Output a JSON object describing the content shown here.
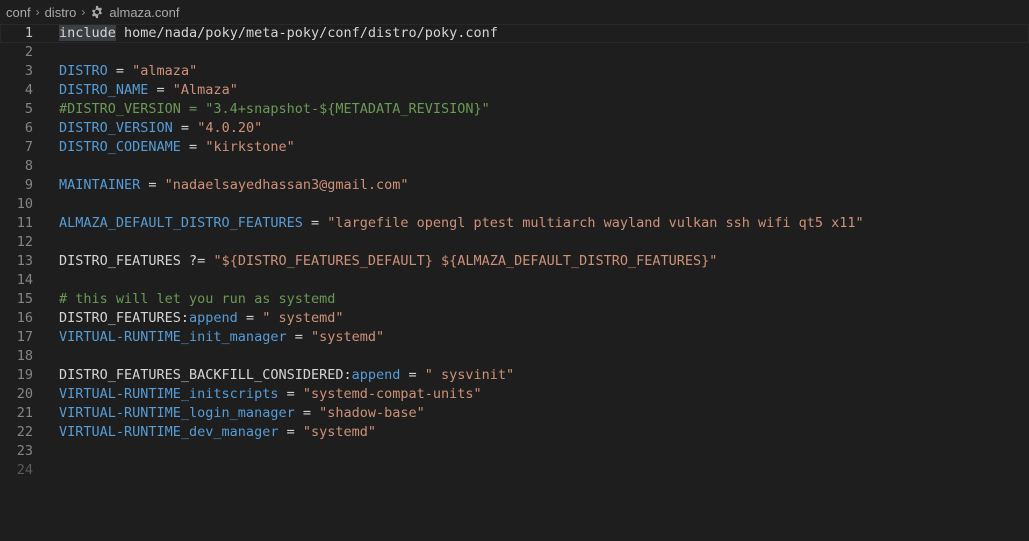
{
  "breadcrumb": {
    "items": [
      "conf",
      "distro",
      "almaza.conf"
    ],
    "file_icon": "gear-icon"
  },
  "colors": {
    "background": "#1e1e1e",
    "variable": "#569cd6",
    "string": "#ce9178",
    "comment": "#6a9955",
    "plain": "#d4d4d4",
    "line_number": "#858585"
  },
  "editor": {
    "current_line": 1,
    "lines": [
      {
        "n": "1",
        "tokens": [
          {
            "t": "include",
            "c": "t-plain kw-hl"
          },
          {
            "t": " home/nada/poky/meta-poky/conf/distro/poky.conf",
            "c": "t-path"
          }
        ]
      },
      {
        "n": "2",
        "tokens": []
      },
      {
        "n": "3",
        "tokens": [
          {
            "t": "DISTRO",
            "c": "t-var"
          },
          {
            "t": " = ",
            "c": "t-plain"
          },
          {
            "t": "\"almaza\"",
            "c": "t-str"
          }
        ]
      },
      {
        "n": "4",
        "tokens": [
          {
            "t": "DISTRO_NAME",
            "c": "t-var"
          },
          {
            "t": " = ",
            "c": "t-plain"
          },
          {
            "t": "\"Almaza\"",
            "c": "t-str"
          }
        ]
      },
      {
        "n": "5",
        "tokens": [
          {
            "t": "#DISTRO_VERSION = \"3.4+snapshot-${METADATA_REVISION}\"",
            "c": "t-com"
          }
        ]
      },
      {
        "n": "6",
        "tokens": [
          {
            "t": "DISTRO_VERSION",
            "c": "t-var"
          },
          {
            "t": " = ",
            "c": "t-plain"
          },
          {
            "t": "\"4.0.20\"",
            "c": "t-str"
          }
        ]
      },
      {
        "n": "7",
        "tokens": [
          {
            "t": "DISTRO_CODENAME",
            "c": "t-var"
          },
          {
            "t": " = ",
            "c": "t-plain"
          },
          {
            "t": "\"kirkstone\"",
            "c": "t-str"
          }
        ]
      },
      {
        "n": "8",
        "tokens": []
      },
      {
        "n": "9",
        "tokens": [
          {
            "t": "MAINTAINER",
            "c": "t-var"
          },
          {
            "t": " = ",
            "c": "t-plain"
          },
          {
            "t": "\"nadaelsayedhassan3@gmail.com\"",
            "c": "t-str"
          }
        ]
      },
      {
        "n": "10",
        "tokens": []
      },
      {
        "n": "11",
        "tokens": [
          {
            "t": "ALMAZA_DEFAULT_DISTRO_FEATURES",
            "c": "t-var"
          },
          {
            "t": " = ",
            "c": "t-plain"
          },
          {
            "t": "\"largefile opengl ptest multiarch wayland vulkan ssh wifi qt5 x11\"",
            "c": "t-str"
          }
        ]
      },
      {
        "n": "12",
        "tokens": []
      },
      {
        "n": "13",
        "tokens": [
          {
            "t": "DISTRO_FEATURES",
            "c": "t-plain"
          },
          {
            "t": " ?= ",
            "c": "t-plain"
          },
          {
            "t": "\"${DISTRO_FEATURES_DEFAULT} ${ALMAZA_DEFAULT_DISTRO_FEATURES}\"",
            "c": "t-str"
          }
        ]
      },
      {
        "n": "14",
        "tokens": []
      },
      {
        "n": "15",
        "tokens": [
          {
            "t": "# this will let you run as systemd",
            "c": "t-com"
          }
        ]
      },
      {
        "n": "16",
        "tokens": [
          {
            "t": "DISTRO_FEATURES:",
            "c": "t-plain"
          },
          {
            "t": "append",
            "c": "t-var"
          },
          {
            "t": " = ",
            "c": "t-plain"
          },
          {
            "t": "\" systemd\"",
            "c": "t-str"
          }
        ]
      },
      {
        "n": "17",
        "tokens": [
          {
            "t": "VIRTUAL-RUNTIME_init_manager",
            "c": "t-var"
          },
          {
            "t": " = ",
            "c": "t-plain"
          },
          {
            "t": "\"systemd\"",
            "c": "t-str"
          }
        ]
      },
      {
        "n": "18",
        "tokens": []
      },
      {
        "n": "19",
        "tokens": [
          {
            "t": "DISTRO_FEATURES_BACKFILL_CONSIDERED:",
            "c": "t-plain"
          },
          {
            "t": "append",
            "c": "t-var"
          },
          {
            "t": " = ",
            "c": "t-plain"
          },
          {
            "t": "\" sysvinit\"",
            "c": "t-str"
          }
        ]
      },
      {
        "n": "20",
        "tokens": [
          {
            "t": "VIRTUAL-RUNTIME_initscripts",
            "c": "t-var"
          },
          {
            "t": " = ",
            "c": "t-plain"
          },
          {
            "t": "\"systemd-compat-units\"",
            "c": "t-str"
          }
        ]
      },
      {
        "n": "21",
        "tokens": [
          {
            "t": "VIRTUAL-RUNTIME_login_manager",
            "c": "t-var"
          },
          {
            "t": " = ",
            "c": "t-plain"
          },
          {
            "t": "\"shadow-base\"",
            "c": "t-str"
          }
        ]
      },
      {
        "n": "22",
        "tokens": [
          {
            "t": "VIRTUAL-RUNTIME_dev_manager",
            "c": "t-var"
          },
          {
            "t": " = ",
            "c": "t-plain"
          },
          {
            "t": "\"systemd\"",
            "c": "t-str"
          }
        ]
      },
      {
        "n": "23",
        "tokens": []
      },
      {
        "n": "24",
        "tokens": [],
        "dim": true
      }
    ]
  }
}
